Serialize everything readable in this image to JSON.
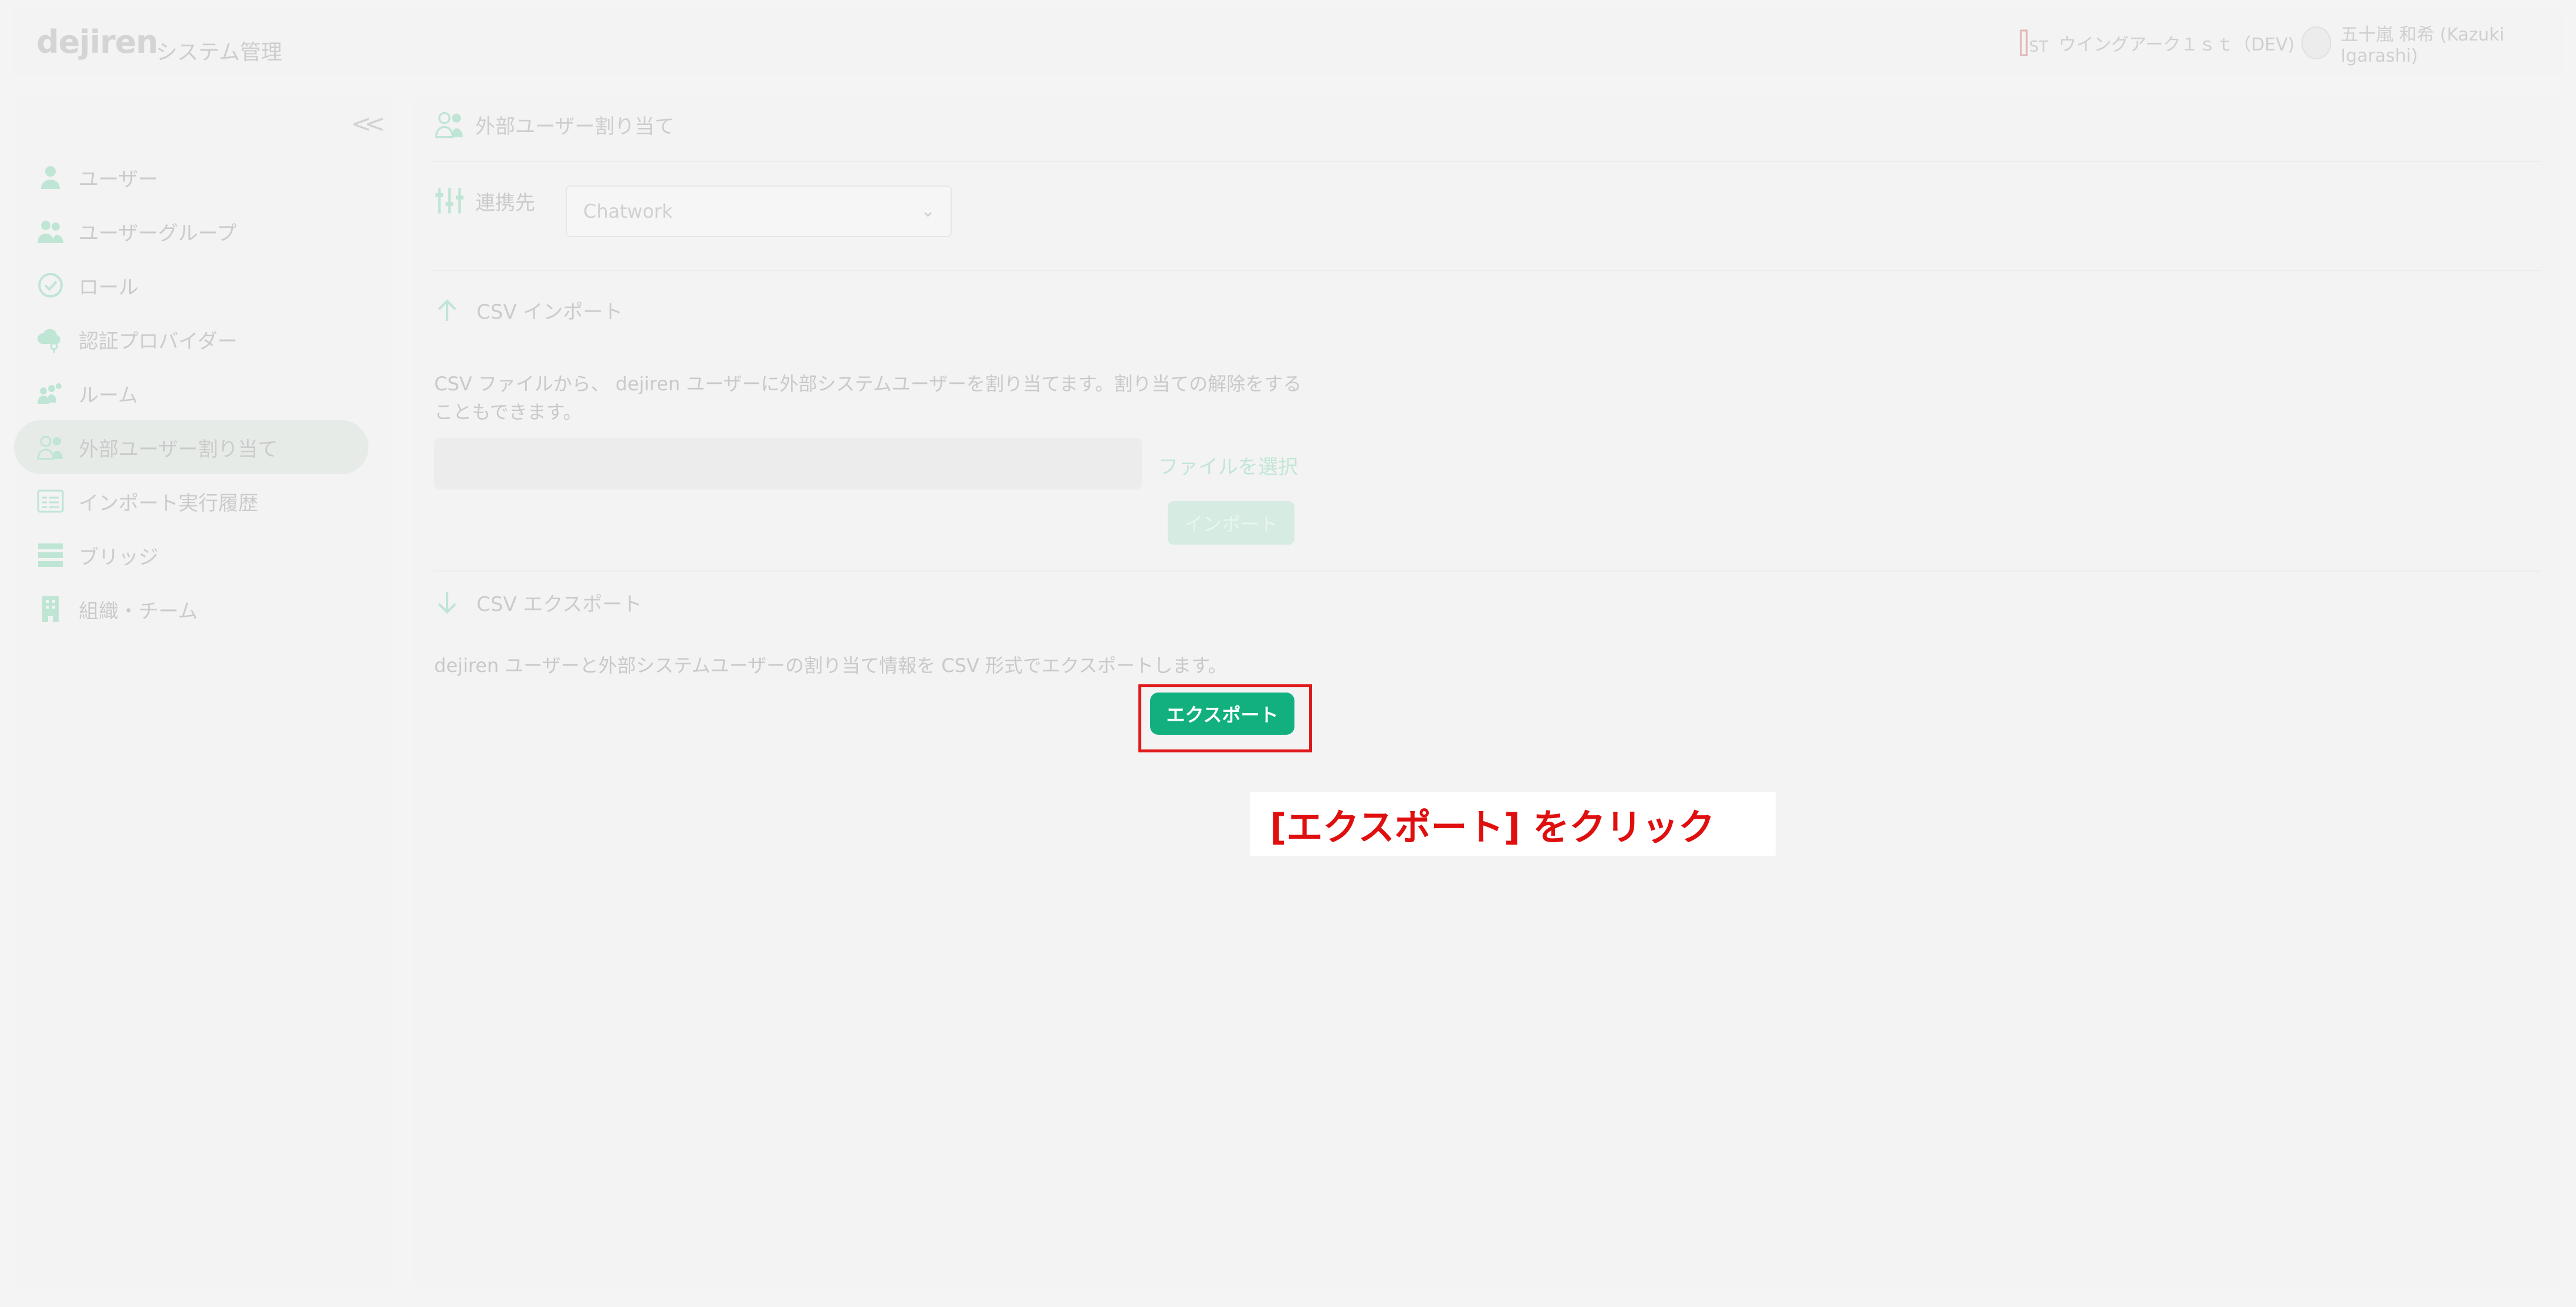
{
  "header": {
    "logo": "dejiren",
    "app_title": "システム管理",
    "org_name": "ウイングアーク１ｓｔ（DEV)",
    "user_name": "五十嵐 和希 (Kazuki Igarashi)"
  },
  "sidebar": {
    "collapse_label": "<<",
    "items": [
      {
        "label": "ユーザー",
        "icon": "user-icon"
      },
      {
        "label": "ユーザーグループ",
        "icon": "user-group-icon"
      },
      {
        "label": "ロール",
        "icon": "check-circle-icon"
      },
      {
        "label": "認証プロバイダー",
        "icon": "cloud-key-icon"
      },
      {
        "label": "ルーム",
        "icon": "room-people-icon"
      },
      {
        "label": "外部ユーザー割り当て",
        "icon": "external-user-icon",
        "active": true
      },
      {
        "label": "インポート実行履歴",
        "icon": "import-history-icon"
      },
      {
        "label": "ブリッジ",
        "icon": "bridge-icon"
      },
      {
        "label": "組織・チーム",
        "icon": "building-icon"
      }
    ]
  },
  "main": {
    "title": "外部ユーザー割り当て",
    "connection": {
      "label": "連携先",
      "selected": "Chatwork"
    },
    "csv_import": {
      "title": "CSV インポート",
      "desc_line1": "CSV ファイルから、 dejiren ユーザーに外部システムユーザーを割り当てます。割り当ての解除をする",
      "desc_line2": "こともできます。",
      "file_select": "ファイルを選択",
      "import_button": "インポート"
    },
    "csv_export": {
      "title": "CSV エクスポート",
      "desc": "dejiren ユーザーと外部システムユーザーの割り当て情報を CSV 形式でエクスポートします。",
      "export_button": "エクスポート"
    }
  },
  "annotation": {
    "callout": "[エクスポート] をクリック"
  },
  "colors": {
    "accent": "#13b07f",
    "highlight": "#e01a1a"
  }
}
